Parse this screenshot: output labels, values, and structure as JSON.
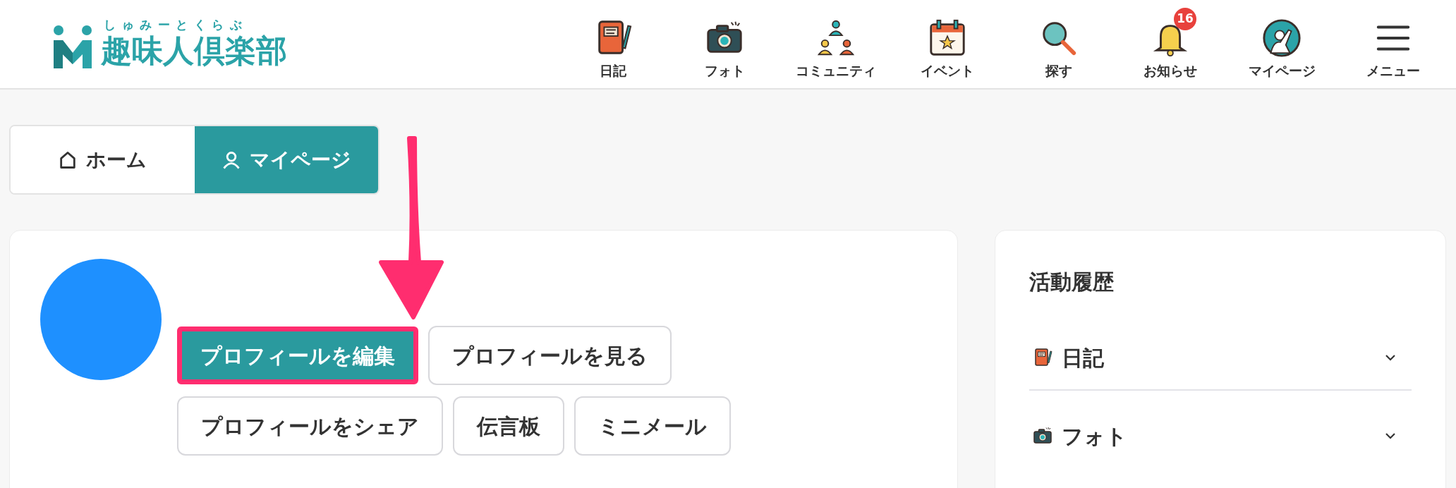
{
  "header": {
    "logo": {
      "ruby": "しゅみーとくらぶ",
      "name": "趣味人倶楽部"
    },
    "nav": [
      {
        "kind": "diary",
        "label": "日記"
      },
      {
        "kind": "camera",
        "label": "フォト"
      },
      {
        "kind": "community",
        "label": "コミュニティ"
      },
      {
        "kind": "calendar",
        "label": "イベント"
      },
      {
        "kind": "search",
        "label": "探す"
      },
      {
        "kind": "bell",
        "label": "お知らせ",
        "badge": "16"
      },
      {
        "kind": "person",
        "label": "マイページ"
      },
      {
        "kind": "menu",
        "label": "メニュー"
      }
    ]
  },
  "tabs": [
    {
      "kind": "home",
      "label": "ホーム",
      "selected": false
    },
    {
      "kind": "person",
      "label": "マイページ",
      "selected": true
    }
  ],
  "profile": {
    "button_rows": [
      [
        {
          "label": "プロフィールを編集",
          "highlighted": true
        },
        {
          "label": "プロフィールを見る",
          "highlighted": false
        }
      ],
      [
        {
          "label": "プロフィールをシェア",
          "highlighted": false
        },
        {
          "label": "伝言板",
          "highlighted": false
        },
        {
          "label": "ミニメール",
          "highlighted": false
        }
      ]
    ]
  },
  "activity": {
    "title": "活動履歴",
    "sections": [
      {
        "kind": "diary",
        "label": "日記",
        "expanded": false
      },
      {
        "kind": "camera",
        "label": "フォト",
        "expanded": false
      }
    ]
  }
}
